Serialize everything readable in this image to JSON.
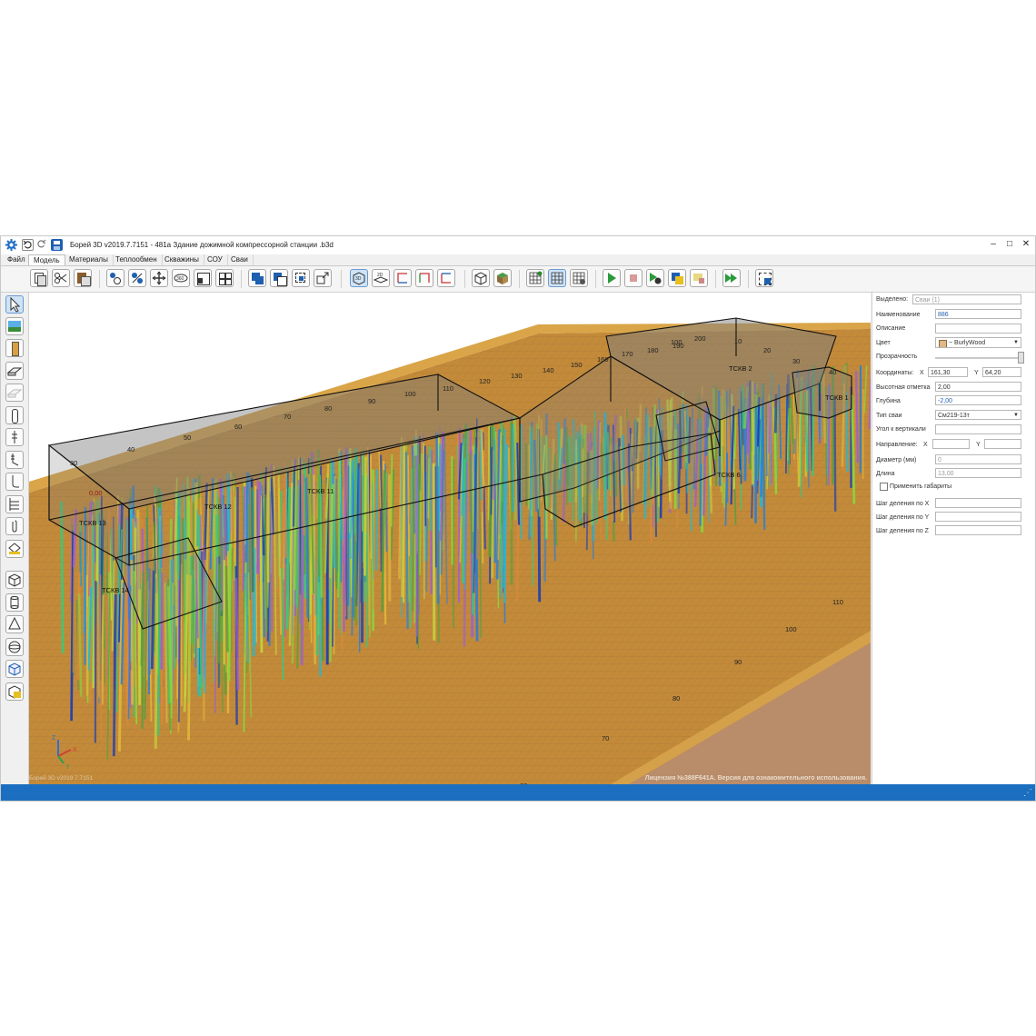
{
  "window": {
    "title": "Борей 3D v2019.7.7151 -  481а Здание дожимной компрессорной станции .b3d",
    "minimize_glyph": "‒",
    "maximize_glyph": "□",
    "close_glyph": "✕"
  },
  "menu": {
    "tabs": [
      "Файл",
      "Модель",
      "Материалы",
      "Теплообмен",
      "Скважины",
      "СОУ",
      "Сваи"
    ],
    "active": "Модель"
  },
  "toolbar": {
    "icons": [
      "copy-icon",
      "scissors-icon",
      "paste-icon",
      "add-objects-icon",
      "split-objects-icon",
      "move-icon",
      "rotate-360-icon",
      "scale-icon",
      "array-icon",
      "union-icon",
      "subtract-icon",
      "intersect-icon",
      "resize-icon",
      "view-3d-icon",
      "view-2d-icon",
      "axis-x-icon",
      "axis-y-icon",
      "axis-z-icon",
      "cube-outline-icon",
      "cube-solid-icon",
      "grid-add-icon",
      "grid-icon",
      "grid-settings-icon",
      "play-icon",
      "stop-icon",
      "run-settings-icon",
      "layers-icon",
      "clear-icon",
      "fast-forward-icon",
      "export-icon"
    ],
    "view_3d_label": "3D",
    "view_2d_label": "2D"
  },
  "left_toolbar": {
    "icons": [
      "select-pointer-icon",
      "image-icon",
      "pile-icon",
      "slab-icon",
      "slab-disabled-icon",
      "pipe-icon",
      "anchor-icon",
      "bent-pile-icon",
      "hook-pile-icon",
      "ladder-icon",
      "paperclip-icon",
      "paint-icon",
      "box-icon",
      "cylinder-icon",
      "cone-icon",
      "sphere-icon",
      "cube-icon",
      "cube-yellow-icon"
    ]
  },
  "viewport": {
    "building_labels": [
      "ТСКВ 14",
      "ТСКВ 13",
      "ТСКВ 12",
      "ТСКВ 11",
      "ТСКВ 6",
      "ТСКВ 2",
      "ТСКВ 1"
    ],
    "elevation_label": "0,00",
    "grid_labels_top": [
      "30",
      "40",
      "50",
      "60",
      "70",
      "80",
      "90",
      "100",
      "110",
      "120",
      "130",
      "140",
      "150",
      "160",
      "170",
      "180",
      "190",
      "100",
      "200",
      "10",
      "20",
      "30",
      "40"
    ],
    "grid_labels_right": [
      "110",
      "100",
      "90",
      "80",
      "70",
      "60"
    ],
    "axes": {
      "x": "X",
      "y": "Y",
      "z": "Z"
    },
    "footer_left": "Борей 3D v2019.7.7151",
    "license_text": "Лицензия №388F641A. Версия для ознакомительного использования.",
    "colors": {
      "ground": "#c38a3a",
      "soil_side": "#b98c6a",
      "grid": "#9c7232",
      "box_edge": "#111111",
      "box_fill": "#7d7d7d"
    }
  },
  "properties": {
    "selected_label": "Выделено:",
    "selected_value": "Сваи (1)",
    "name_label": "Наименование",
    "name_value": "886",
    "description_label": "Описание",
    "description_value": "",
    "color_label": "Цвет",
    "color_value": "~ BurlyWood",
    "color_swatch": "#deb887",
    "transparency_label": "Прозрачность",
    "transparency_level": 1.0,
    "coords_label": "Координаты:",
    "x_label": "X",
    "x_value": "161,30",
    "y_label": "Y",
    "y_value": "64,20",
    "elevation_label": "Высотная отметка",
    "elevation_value": "2,00",
    "depth_label": "Глубина",
    "depth_value": "-2,00",
    "pile_type_label": "Тип сваи",
    "pile_type_value": "См219-13т",
    "angle_label": "Угол к вертикали",
    "angle_value": "",
    "direction_label": "Направление:",
    "dir_x_label": "X",
    "dir_x_value": "",
    "dir_y_label": "Y",
    "dir_y_value": "",
    "diameter_label": "Диаметр (мм)",
    "diameter_value": "0",
    "length_label": "Длина",
    "length_value": "13,00",
    "apply_dims_label": "Применить габариты",
    "step_x_label": "Шаг деления по X",
    "step_y_label": "Шаг деления по Y",
    "step_z_label": "Шаг деления по Z"
  }
}
